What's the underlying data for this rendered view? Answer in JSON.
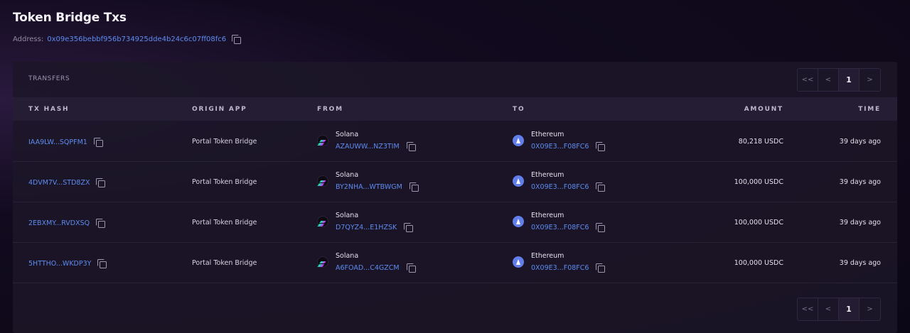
{
  "page": {
    "title": "Token Bridge Txs",
    "address_label": "Address:",
    "address_value": "0x09e356bebbf956b734925dde4b24c6c07ff08fc6"
  },
  "panel": {
    "title": "TRANSFERS"
  },
  "pager": {
    "first": "<<",
    "prev": "<",
    "current": "1",
    "next": ">"
  },
  "table": {
    "columns": [
      "TX HASH",
      "ORIGIN APP",
      "FROM",
      "TO",
      "AMOUNT",
      "TIME"
    ],
    "rows": [
      {
        "hash": "IAA9LW...SQPFM1",
        "origin": "Portal Token Bridge",
        "from_chain": "Solana",
        "from_addr": "AZAUWW...NZ3TIM",
        "to_chain": "Ethereum",
        "to_addr": "0X09E3...F08FC6",
        "amount": "80,218 USDC",
        "time": "39 days ago"
      },
      {
        "hash": "4DVM7V...STD8ZX",
        "origin": "Portal Token Bridge",
        "from_chain": "Solana",
        "from_addr": "BY2NHA...WTBWGM",
        "to_chain": "Ethereum",
        "to_addr": "0X09E3...F08FC6",
        "amount": "100,000 USDC",
        "time": "39 days ago"
      },
      {
        "hash": "2EBXMY...RVDXSQ",
        "origin": "Portal Token Bridge",
        "from_chain": "Solana",
        "from_addr": "D7QYZ4...E1HZSK",
        "to_chain": "Ethereum",
        "to_addr": "0X09E3...F08FC6",
        "amount": "100,000 USDC",
        "time": "39 days ago"
      },
      {
        "hash": "5HTTHO...WKDP3Y",
        "origin": "Portal Token Bridge",
        "from_chain": "Solana",
        "from_addr": "A6FOAD...C4GZCM",
        "to_chain": "Ethereum",
        "to_addr": "0X09E3...F08FC6",
        "amount": "100,000 USDC",
        "time": "39 days ago"
      }
    ]
  },
  "icons": {
    "copy": "copy-icon",
    "solana": "solana-icon",
    "ethereum": "ethereum-icon"
  },
  "colors": {
    "link": "#5e8cf0",
    "ethereum": "#627eea"
  }
}
